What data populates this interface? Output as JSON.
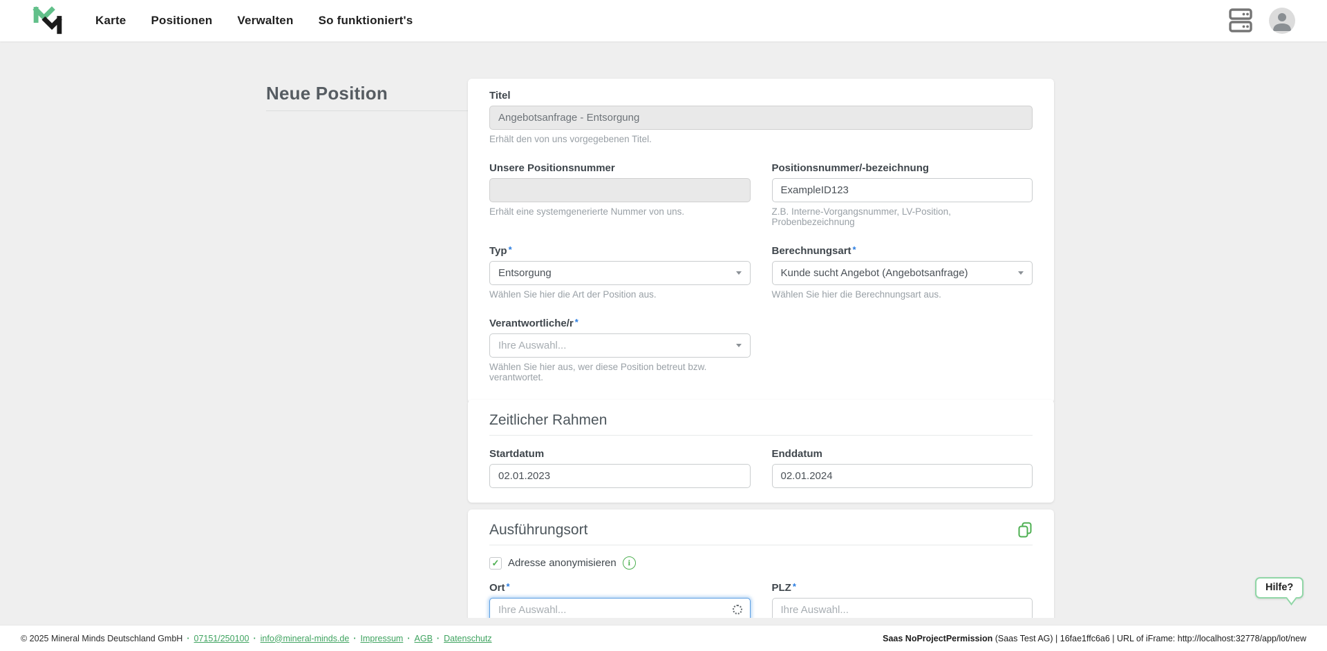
{
  "header": {
    "nav": [
      {
        "label": "Karte"
      },
      {
        "label": "Positionen"
      },
      {
        "label": "Verwalten"
      },
      {
        "label": "So funktioniert's"
      }
    ]
  },
  "page": {
    "title": "Neue Position"
  },
  "form": {
    "titel": {
      "label": "Titel",
      "value": "Angebotsanfrage - Entsorgung",
      "helper": "Erhält den von uns vorgegebenen Titel."
    },
    "unsere_positionsnummer": {
      "label": "Unsere Positionsnummer",
      "value": "",
      "helper": "Erhält eine systemgenerierte Nummer von uns."
    },
    "positionsnummer": {
      "label": "Positionsnummer/-bezeichnung",
      "value": "ExampleID123",
      "helper": "Z.B. Interne-Vorgangsnummer, LV-Position, Probenbezeichnung"
    },
    "typ": {
      "label": "Typ",
      "required": "*",
      "value": "Entsorgung",
      "helper": "Wählen Sie hier die Art der Position aus."
    },
    "berechnungsart": {
      "label": "Berechnungsart",
      "required": "*",
      "value": "Kunde sucht Angebot (Angebotsanfrage)",
      "helper": "Wählen Sie hier die Berechnungsart aus."
    },
    "verantwortliche": {
      "label": "Verantwortliche/r",
      "required": "*",
      "placeholder": "Ihre Auswahl...",
      "helper": "Wählen Sie hier aus, wer diese Position betreut bzw. verantwortet."
    }
  },
  "zeitlicher_rahmen": {
    "heading": "Zeitlicher Rahmen",
    "startdatum": {
      "label": "Startdatum",
      "value": "02.01.2023"
    },
    "enddatum": {
      "label": "Enddatum",
      "value": "02.01.2024"
    }
  },
  "ausfuehrungsort": {
    "heading": "Ausführungsort",
    "anonymisieren_label": "Adresse anonymisieren",
    "checkbox_check": "✓",
    "info_glyph": "i",
    "ort": {
      "label": "Ort",
      "required": "*",
      "placeholder": "Ihre Auswahl..."
    },
    "plz": {
      "label": "PLZ",
      "required": "*",
      "placeholder": "Ihre Auswahl..."
    }
  },
  "help_button": {
    "label": "Hilfe?"
  },
  "footer": {
    "copyright": "© 2025 Mineral Minds Deutschland GmbH",
    "separator": "·",
    "links": [
      {
        "label": "07151/250100"
      },
      {
        "label": "info@mineral-minds.de"
      },
      {
        "label": "Impressum"
      },
      {
        "label": "AGB"
      },
      {
        "label": "Datenschutz"
      }
    ],
    "right_bold": "Saas NoProjectPermission",
    "right_rest": " (Saas Test AG) | 16fae1ffc6a6 | URL of iFrame: http://localhost:32778/app/lot/new"
  },
  "colors": {
    "brand_green": "#4caf50",
    "logo_green": "#62c08a",
    "logo_black": "#1b1b1b",
    "required_blue": "#2b7de0",
    "focus_blue": "#5a9ee2",
    "page_background": "#efefef"
  }
}
